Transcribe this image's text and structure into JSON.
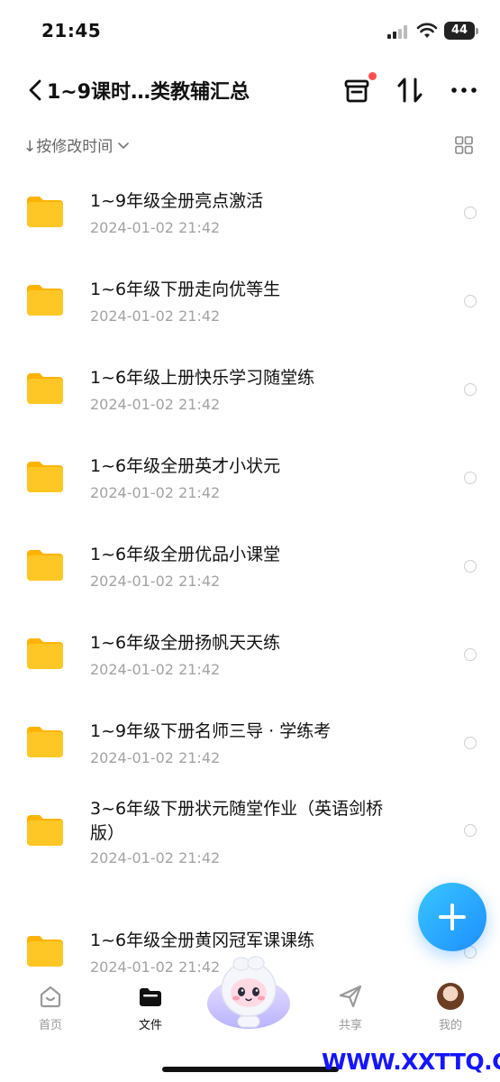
{
  "status_bar": {
    "time": "21:45",
    "battery": "44"
  },
  "header": {
    "title": "1~9课时…类教辅汇总"
  },
  "sort": {
    "label": "↓按修改时间"
  },
  "files": [
    {
      "name": "1~9年级全册亮点激活",
      "date": "2024-01-02 21:42"
    },
    {
      "name": "1~6年级下册走向优等生",
      "date": "2024-01-02 21:42"
    },
    {
      "name": "1~6年级上册快乐学习随堂练",
      "date": "2024-01-02 21:42"
    },
    {
      "name": "1~6年级全册英才小状元",
      "date": "2024-01-02 21:42"
    },
    {
      "name": "1~6年级全册优品小课堂",
      "date": "2024-01-02 21:42"
    },
    {
      "name": "1~6年级全册扬帆天天练",
      "date": "2024-01-02 21:42"
    },
    {
      "name": "1~9年级下册名师三导 · 学练考",
      "date": "2024-01-02 21:42"
    },
    {
      "name": "3~6年级下册状元随堂作业（英语剑桥版）",
      "date": "2024-01-02 21:42"
    },
    {
      "name": "1~6年级全册黄冈冠军课课练",
      "date": "2024-01-02 21:42"
    }
  ],
  "nav": [
    {
      "label": "首页",
      "icon": "home-icon"
    },
    {
      "label": "文件",
      "icon": "folder-icon"
    },
    {
      "label": "共享",
      "icon": "send-icon"
    },
    {
      "label": "我的",
      "icon": "avatar"
    }
  ],
  "colors": {
    "accent": "#1f8eff",
    "folder": "#ffc726",
    "watermark": "#1515ff",
    "badge": "#ff4d4f"
  },
  "watermark": "WWW.XXTTQ.COM"
}
